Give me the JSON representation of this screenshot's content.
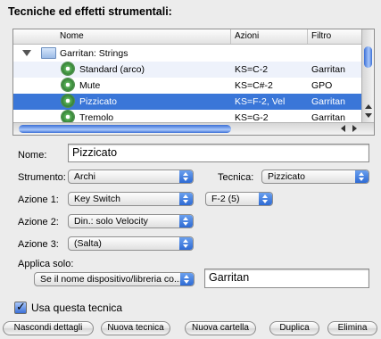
{
  "title": "Tecniche ed effetti strumentali:",
  "table": {
    "columns": [
      "Nome",
      "Azioni",
      "Filtro"
    ],
    "group": "Garritan: Strings",
    "rows": [
      {
        "name": "Standard (arco)",
        "action": "KS=C-2",
        "filter": "Garritan",
        "selected": false
      },
      {
        "name": "Mute",
        "action": "KS=C#-2",
        "filter": "GPO",
        "selected": false
      },
      {
        "name": "Pizzicato",
        "action": "KS=F-2, Vel",
        "filter": "Garritan",
        "selected": true
      },
      {
        "name": "Tremolo",
        "action": "KS=G-2",
        "filter": "Garritan",
        "selected": false
      }
    ]
  },
  "form": {
    "name_label": "Nome:",
    "name_value": "Pizzicato",
    "strumento_label": "Strumento:",
    "strumento_value": "Archi",
    "tecnica_label": "Tecnica:",
    "tecnica_value": "Pizzicato",
    "azione1_label": "Azione 1:",
    "azione1_value": "Key Switch",
    "azione1_param": "F-2 (5)",
    "azione2_label": "Azione 2:",
    "azione2_value": "Din.: solo Velocity",
    "azione3_label": "Azione 3:",
    "azione3_value": "(Salta)",
    "applica_label": "Applica solo:",
    "applica_value": "Se il nome dispositivo/libreria co...",
    "applica_text": "Garritan",
    "use_label": "Usa questa tecnica",
    "use_checked": true
  },
  "buttons": {
    "hide": "Nascondi dettagli",
    "new_tech": "Nuova tecnica",
    "new_folder": "Nuova cartella",
    "duplicate": "Duplica",
    "delete": "Elimina"
  },
  "colors": {
    "selection": "#3a76d8",
    "accent": "#2e6ad4"
  }
}
